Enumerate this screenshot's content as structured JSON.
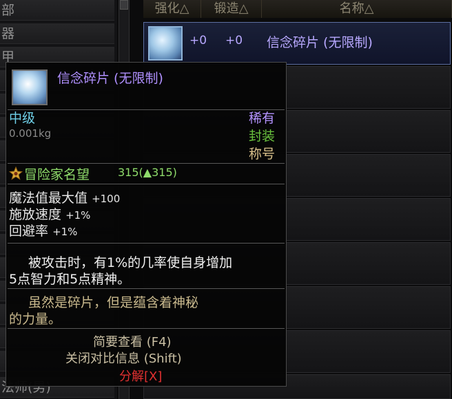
{
  "categories": [
    "部",
    "器",
    "甲",
    "",
    "",
    "",
    "",
    "",
    "",
    "",
    "",
    "",
    "",
    "",
    "",
    "",
    "法师(男)"
  ],
  "header": {
    "enhance": "强化△",
    "forge": "锻造△",
    "name": "名称△"
  },
  "selected_row": {
    "enhance": "+0",
    "forge": "+0",
    "name": "信念碎片 (无限制)"
  },
  "tooltip": {
    "name": "信念碎片 (无限制)",
    "grade": "中级",
    "weight": "0.001kg",
    "rarity": "稀有",
    "seal": "封装",
    "item_type": "称号",
    "fame_label": "冒险家名望",
    "fame_value": "315(▲315)",
    "stats": [
      {
        "label": "魔法值最大值",
        "value": "+100"
      },
      {
        "label": "施放速度",
        "value": "+1%"
      },
      {
        "label": "回避率",
        "value": "+1%"
      }
    ],
    "description_line1": "被攻击时，有1%的几率使自身增加",
    "description_line2": "5点智力和5点精神。",
    "flavor_line1": "虽然是碎片，但是蕴含着神秘",
    "flavor_line2": "的力量。",
    "hint_brief": "简要查看 (F4)",
    "hint_compare": "关闭对比信息 (Shift)",
    "decompose": "分解[X]"
  },
  "colors": {
    "purple": "#b090ff",
    "cyan": "#6fd0e8",
    "green": "#6ac23e",
    "gold": "#d8c08a",
    "red": "#e03030"
  }
}
